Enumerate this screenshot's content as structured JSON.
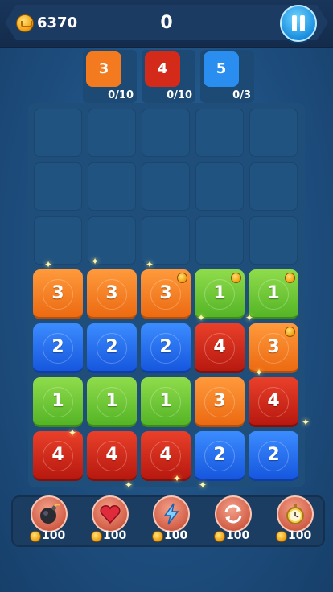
{
  "header": {
    "coins": "6370",
    "score": "0",
    "coin_icon": "coin-icon",
    "pause_icon": "pause-icon"
  },
  "targets": [
    {
      "number": "3",
      "progress": "0/10",
      "color": "#f47a1f"
    },
    {
      "number": "4",
      "progress": "0/10",
      "color": "#d42a1a"
    },
    {
      "number": "5",
      "progress": "0/3",
      "color": "#2a8df0"
    }
  ],
  "board": {
    "columns": 5,
    "rows": 7,
    "tiles": [
      [
        null,
        null,
        null,
        null,
        null
      ],
      [
        null,
        null,
        null,
        null,
        null
      ],
      [
        null,
        null,
        null,
        null,
        null
      ],
      [
        {
          "n": "3",
          "c": "orange"
        },
        {
          "n": "3",
          "c": "orange"
        },
        {
          "n": "3",
          "c": "orange",
          "coin": true
        },
        {
          "n": "1",
          "c": "green",
          "coin": true
        },
        {
          "n": "1",
          "c": "green",
          "coin": true
        }
      ],
      [
        {
          "n": "2",
          "c": "blue"
        },
        {
          "n": "2",
          "c": "blue"
        },
        {
          "n": "2",
          "c": "blue"
        },
        {
          "n": "4",
          "c": "red"
        },
        {
          "n": "3",
          "c": "orange",
          "coin": true
        }
      ],
      [
        {
          "n": "1",
          "c": "green"
        },
        {
          "n": "1",
          "c": "green"
        },
        {
          "n": "1",
          "c": "green"
        },
        {
          "n": "3",
          "c": "orange"
        },
        {
          "n": "4",
          "c": "red"
        }
      ],
      [
        {
          "n": "4",
          "c": "red"
        },
        {
          "n": "4",
          "c": "red"
        },
        {
          "n": "4",
          "c": "red"
        },
        {
          "n": "2",
          "c": "blue"
        },
        {
          "n": "2",
          "c": "blue"
        }
      ]
    ]
  },
  "powerups": [
    {
      "name": "bomb",
      "icon": "bomb-icon",
      "cost": "100"
    },
    {
      "name": "heart",
      "icon": "heart-icon",
      "cost": "100"
    },
    {
      "name": "lightning",
      "icon": "lightning-icon",
      "cost": "100"
    },
    {
      "name": "shuffle",
      "icon": "shuffle-icon",
      "cost": "100"
    },
    {
      "name": "timer",
      "icon": "stopwatch-icon",
      "cost": "100"
    }
  ]
}
